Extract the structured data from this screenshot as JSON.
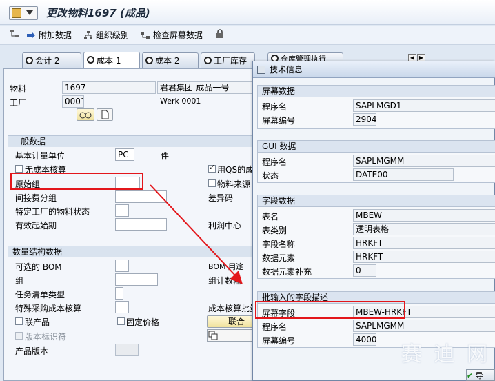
{
  "title": "更改物料1697 (成品)",
  "toolbar": {
    "items": [
      "附加数据",
      "组织级别",
      "检查屏幕数据"
    ]
  },
  "tabs": [
    "会计 2",
    "成本 1",
    "成本 2",
    "工厂库存",
    "仓库管理执行"
  ],
  "header": {
    "material_label": "物料",
    "material_value": "1697",
    "material_desc": "君君集团-成品一号",
    "plant_label": "工厂",
    "plant_value": "0001",
    "plant_desc": "Werk 0001"
  },
  "general": {
    "head": "一般数据",
    "base_uom_label": "基本计量单位",
    "base_uom_value": "PC",
    "base_uom_text": "件",
    "no_costing_label": "无成本核算",
    "origin_group_label": "原始组",
    "overhead_group_label": "间接费分组",
    "plant_status_label": "特定工厂的物料状态",
    "valid_from_label": "有效起始期",
    "qs_costing_label": "用QS的成",
    "material_origin_label": "物料来源",
    "variance_key_label": "差异码",
    "profit_center_label": "利润中心"
  },
  "qty": {
    "head": "数量结构数据",
    "alt_bom_label": "可选的 BOM",
    "group_label": "组",
    "task_list_type_label": "任务清单类型",
    "special_proc_label": "特殊采购成本核算",
    "coproduct_label": "联产品",
    "fixed_price_label": "固定价格",
    "version_ind_label": "版本标识符",
    "prod_version_label": "产品版本",
    "bom_usage_label": "BOM 用途",
    "group_counter_label": "组计数器",
    "lot_size_label": "成本核算批量",
    "btn_label": "联合"
  },
  "dialog": {
    "title": "技术信息",
    "screen": {
      "head": "屏幕数据",
      "program_label": "程序名",
      "program_value": "SAPLMGD1",
      "screen_no_label": "屏幕编号",
      "screen_no_value": "2904"
    },
    "gui": {
      "head": "GUI 数据",
      "program_label": "程序名",
      "program_value": "SAPLMGMM",
      "status_label": "状态",
      "status_value": "DATE00"
    },
    "field": {
      "head": "字段数据",
      "table_label": "表名",
      "table_value": "MBEW",
      "table_cat_label": "表类别",
      "table_cat_value": "透明表格",
      "field_name_label": "字段名称",
      "field_name_value": "HRKFT",
      "data_elem_label": "数据元素",
      "data_elem_value": "HRKFT",
      "data_elem_supp_label": "数据元素补充",
      "data_elem_supp_value": "0"
    },
    "batch": {
      "head": "批输入的字段描述",
      "screen_field_label": "屏幕字段",
      "screen_field_value": "MBEW-HRKFT",
      "program_label": "程序名",
      "program_value": "SAPLMGMM",
      "screen_no_label": "屏幕编号",
      "screen_no_value": "4000"
    },
    "ok_label": "导"
  },
  "watermark": "赛 迪 网",
  "colors": {
    "highlight": "#e3161b",
    "arrow": "#e3161b"
  }
}
